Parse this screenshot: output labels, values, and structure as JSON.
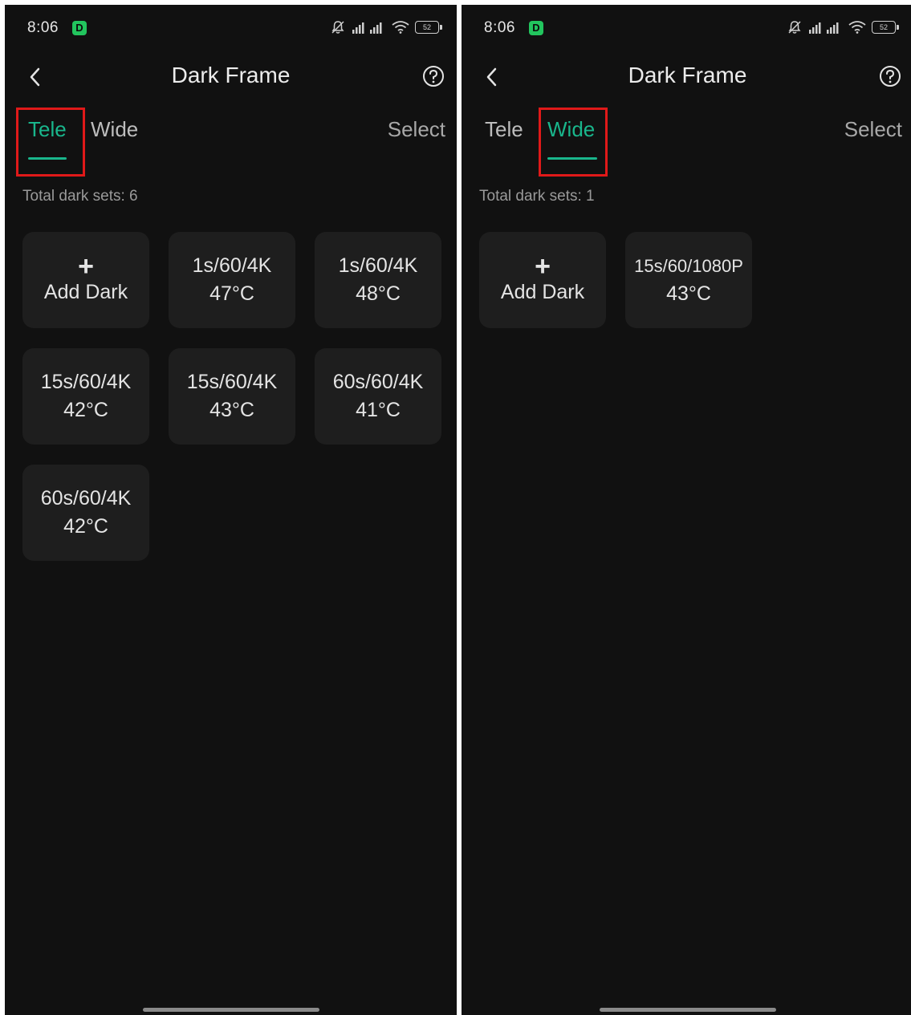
{
  "screens": [
    {
      "status": {
        "time": "8:06",
        "app_badge": "D",
        "battery": "52"
      },
      "header": {
        "title": "Dark Frame"
      },
      "tabs": [
        {
          "label": "Tele",
          "active": true
        },
        {
          "label": "Wide",
          "active": false
        }
      ],
      "select_label": "Select",
      "total_label": "Total dark sets: 6",
      "add_tile": {
        "icon": "plus-icon",
        "label": "Add Dark"
      },
      "dark_sets": [
        {
          "settings": "1s/60/4K",
          "temp": "47°C"
        },
        {
          "settings": "1s/60/4K",
          "temp": "48°C"
        },
        {
          "settings": "15s/60/4K",
          "temp": "42°C"
        },
        {
          "settings": "15s/60/4K",
          "temp": "43°C"
        },
        {
          "settings": "60s/60/4K",
          "temp": "41°C"
        },
        {
          "settings": "60s/60/4K",
          "temp": "42°C"
        }
      ]
    },
    {
      "status": {
        "time": "8:06",
        "app_badge": "D",
        "battery": "52"
      },
      "header": {
        "title": "Dark Frame"
      },
      "tabs": [
        {
          "label": "Tele",
          "active": false
        },
        {
          "label": "Wide",
          "active": true
        }
      ],
      "select_label": "Select",
      "total_label": "Total dark sets: 1",
      "add_tile": {
        "icon": "plus-icon",
        "label": "Add Dark"
      },
      "dark_sets": [
        {
          "settings": "15s/60/1080P",
          "temp": "43°C"
        }
      ]
    }
  ],
  "colors": {
    "accent": "#19b68c",
    "highlight": "#e01919",
    "background": "#111111",
    "tile": "#1e1e1e"
  },
  "icons": [
    "back-chevron-icon",
    "help-circle-icon",
    "plus-icon",
    "mute-bell-icon",
    "signal-icon",
    "wifi-icon",
    "battery-icon"
  ]
}
